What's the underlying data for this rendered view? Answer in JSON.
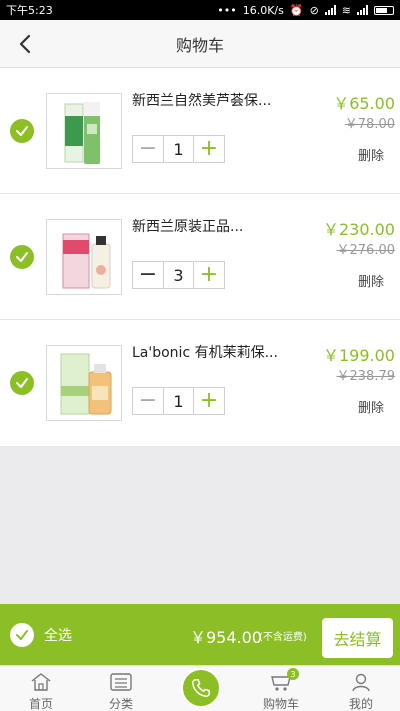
{
  "status_bar": {
    "time": "下午5:23",
    "speed": "16.0K/s",
    "icons": [
      "alarm-icon",
      "mute-icon",
      "signal-icon",
      "wifi-icon",
      "signal-icon",
      "battery-icon"
    ]
  },
  "header": {
    "title": "购物车",
    "back_icon": "back-chevron-icon"
  },
  "cart": {
    "items": [
      {
        "name": "新西兰自然美芦荟保...",
        "price": "￥65.00",
        "old_price": "￥78.00",
        "quantity": "1",
        "delete_label": "删除",
        "selected": true
      },
      {
        "name": "新西兰原装正品...",
        "price": "￥230.00",
        "old_price": "￥276.00",
        "quantity": "3",
        "delete_label": "删除",
        "selected": true
      },
      {
        "name": "La'bonic 有机茉莉保...",
        "price": "￥199.00",
        "old_price": "￥238.79",
        "quantity": "1",
        "delete_label": "删除",
        "selected": true
      }
    ]
  },
  "footer": {
    "select_all_label": "全选",
    "total": "￥954.00",
    "shipping_note": "(不含运费)",
    "checkout_label": "去结算"
  },
  "tabbar": {
    "tabs": [
      {
        "label": "首页",
        "icon": "home-icon"
      },
      {
        "label": "分类",
        "icon": "category-icon"
      },
      {
        "label": "",
        "icon": "phone-icon"
      },
      {
        "label": "购物车",
        "icon": "cart-icon",
        "badge": "3"
      },
      {
        "label": "我的",
        "icon": "user-icon"
      }
    ]
  },
  "colors": {
    "accent": "#8cbf26",
    "header_bg": "#f7f7f7",
    "page_bg": "#ebebed"
  }
}
